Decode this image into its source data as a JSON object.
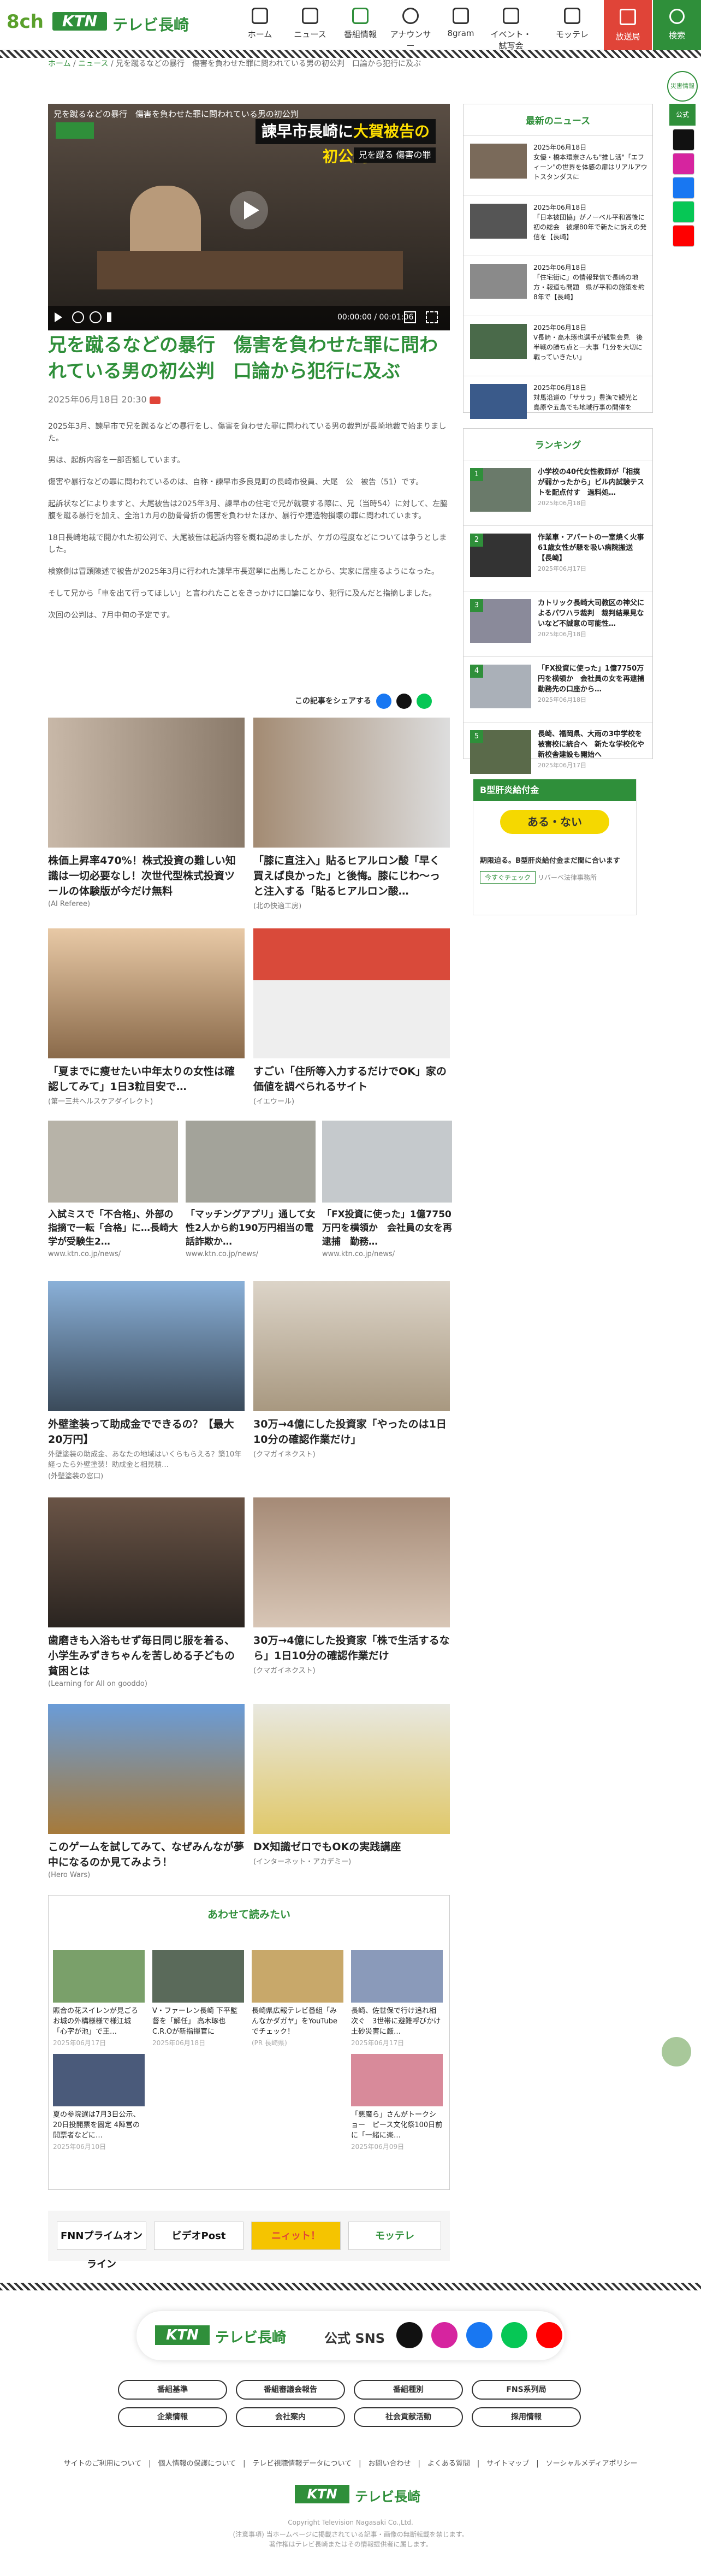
{
  "header": {
    "logo_8ch": "8ch",
    "logo_ktn": "KTN",
    "logo_tv": "テレビ長崎",
    "nav": [
      {
        "label": "ホーム",
        "icon": "home-icon"
      },
      {
        "label": "ニュース",
        "icon": "news-icon"
      },
      {
        "label": "番組情報",
        "icon": "tv-icon"
      },
      {
        "label": "アナウンサー",
        "icon": "announcer-icon"
      },
      {
        "label": "8gram",
        "icon": "camera-icon"
      },
      {
        "label": "イベント・試写会",
        "icon": "event-icon"
      },
      {
        "label": "モッテレ",
        "icon": "shop-icon"
      }
    ],
    "live": "放送局",
    "search": "検索"
  },
  "right_rail": {
    "label": "災害情報",
    "sns_label": "公式SNS"
  },
  "breadcrumb": {
    "home": "ホーム",
    "sep": "/",
    "news": "ニュース",
    "current": "兄を蹴るなどの暴行　傷害を負わせた罪に問われている男の初公判　口論から犯行に及ぶ"
  },
  "video": {
    "caption": "兄を蹴るなどの暴行　傷害を負わせた罪に問われている男の初公判",
    "title_white": "諫早市長崎に",
    "title_yellow": "大賀被告の初公判",
    "subtitle": "兄を蹴る 傷害の罪",
    "time": "00:00:00 / 00:01:06"
  },
  "article": {
    "title": "兄を蹴るなどの暴行　傷害を負わせた罪に問われている男の初公判　口論から犯行に及ぶ",
    "date": "2025年06月18日 20:30",
    "paragraphs": [
      "2025年3月、諫早市で兄を蹴るなどの暴行をし、傷害を負わせた罪に問われている男の裁判が長崎地裁で始まりました。",
      "男は、起訴内容を一部否認しています。",
      "傷害や暴行などの罪に問われているのは、自称・諫早市多良見町の長崎市役員、大尾　公　被告（51）です。",
      "起訴状などによりますと、大尾被告は2025年3月、諫早市の住宅で兄が就寝する際に、兄（当時54）に対して、左脇腹を蹴る暴行を加え、全治1カ月の肋骨骨折の傷害を負わせたほか、暴行や建造物損壊の罪に問われています。",
      "18日長崎地裁で開かれた初公判で、大尾被告は起訴内容を概ね認めましたが、ケガの程度などについては争うとしました。",
      "検察側は冒頭陳述で被告が2025年3月に行われた諫早市長選挙に出馬したことから、実家に居座るようになった。",
      "そして兄から「車を出て行ってほしい」と言われたことをきっかけに口論になり、犯行に及んだと指摘しました。",
      "次回の公判は、7月中旬の予定です。"
    ],
    "share_label": "この記事をシェアする"
  },
  "ads": [
    {
      "title": "株価上昇率470%！株式投資の難しい知識は一切必要なし！次世代型株式投資ツールの体験版が今だけ無料",
      "src": "(AI Referee)"
    },
    {
      "title": "「膝に直注入」貼るヒアルロン酸「早く買えば良かった」と後悔。膝にじわ〜っと注入する「貼るヒアルロン酸…",
      "src": "(北の快適工房)"
    },
    {
      "title": "「夏までに痩せたい中年太りの女性は確認してみて」1日3粒目安で…",
      "src": "(第一三共ヘルスケアダイレクト)"
    },
    {
      "title": "すごい「住所等入力するだけでOK」家の価値を調べられるサイト",
      "src": "(イエウール)"
    },
    {
      "title": "入試ミスで「不合格」、外部の指摘で一転「合格」に…長崎大学が受験生2…",
      "src": "www.ktn.co.jp/news/"
    },
    {
      "title": "「マッチングアプリ」通して女性2人から約190万円相当の電話詐欺か…",
      "src": "www.ktn.co.jp/news/"
    },
    {
      "title": "「FX投資に使った」1億7750万円を横領か　会社員の女を再逮捕　勤務…",
      "src": "www.ktn.co.jp/news/"
    },
    {
      "title": "外壁塗装って助成金でできるの？【最大20万円】",
      "desc": "外壁塗装の助成金、あなたの地域はいくらもらえる？築10年経ったら外壁塗装！助成金と相見積…",
      "src": "(外壁塗装の窓口)"
    },
    {
      "title": "30万→4億にした投資家「やったのは1日10分の確認作業だけ」",
      "src": "(クマガイネクスト)"
    },
    {
      "title": "歯磨きも入浴もせず毎日同じ服を着る、小学生みずきちゃんを苦しめる子どもの貧困とは",
      "src": "(Learning for All on gooddo)"
    },
    {
      "title": "30万→4億にした投資家「株で生活するなら」1日10分の確認作業だけ",
      "src": "(クマガイネクスト)"
    },
    {
      "title": "このゲームを試してみて、なぜみんなが夢中になるのか見てみよう！",
      "src": "(Hero Wars)"
    },
    {
      "title": "DX知識ゼロでもOKの実践講座",
      "src": "(インターネット・アカデミー)"
    }
  ],
  "sidebar": {
    "latest_title": "最新のニュース",
    "latest": [
      {
        "text": "2025年06月18日\n女優・橋本環奈さんも\"推し活\"「エフィーン\"の世界を体感の扉はリアルアウトスタンダスに"
      },
      {
        "text": "2025年06月18日\n「日本被団協」がノーベル平和賞後に初の総会　被爆80年で新たに訴えの発信を【長崎】"
      },
      {
        "text": "2025年06月18日\n「住宅街に」の情報発信で長崎の地方・報道も問題　県が平和の施策を約8年で【長崎】"
      },
      {
        "text": "2025年06月18日\nV長崎・高木琢也選手が観覧会見　後半戦の勝ち点と一大事「1分を大切に戦っていきたい」"
      },
      {
        "text": "2025年06月18日\n対馬沿道の「ササラ」豊漁で観光と　島原や五島でも地域行事の開催を"
      }
    ],
    "ranking_title": "ランキング",
    "ranking": [
      {
        "num": "1",
        "text": "小学校の40代女性教師が「相撲が弱かったから」ビル内試験テストを配点付す　過料処…",
        "date": "2025年06月18日"
      },
      {
        "num": "2",
        "text": "作業車・アパートの一室焼く火事　61歳女性が懸を吸い病院搬送【長崎】",
        "date": "2025年06月17日"
      },
      {
        "num": "3",
        "text": "カトリック長崎大司教区の神父によるパワハラ裁判　裁判結果見ないなど不誠意の可能性…",
        "date": "2025年06月18日"
      },
      {
        "num": "4",
        "text": "「FX投資に使った」1億7750万円を横領か　会社員の女を再逮捕　勤務先の口座から…",
        "date": "2025年06月18日"
      },
      {
        "num": "5",
        "text": "長崎、福岡県、大雨の3中学校を被害校に統合へ　新たな学校化や新校舎建設も開始へ",
        "date": "2025年06月17日"
      }
    ],
    "promo_title": "ある・ない",
    "promo_line1": "B型肝炎給付金",
    "promo_text": "期限迫る。B型肝炎給付金まだ間に合います",
    "promo_btn": "今すぐチェック",
    "promo_src": "リバーベ法律事務所"
  },
  "related": {
    "title": "あわせて読みたい",
    "items": [
      {
        "t": "賑合の花スイレンが見ごろ　お城の外構様様で様江城「心字が池」で王…",
        "d": "2025年06月17日"
      },
      {
        "t": "V・ファーレン長崎 下平監督を「解任」 高木琢也C.R.Oが新指揮官に",
        "d": "2025年06月18日"
      },
      {
        "t": "長崎県広報テレビ番組「みんなかダガヤ」をYouTubeでチェック！",
        "d": "(PR 長崎県)"
      },
      {
        "t": "長崎、佐世保で行け追れ相次ぐ　3世帯に避難呼びかけ　土砂災害に厳…",
        "d": "2025年06月17日"
      },
      {
        "t": "夏の参院選は7月3日公示、20日投開票を固定 4陣営の開票者などに…",
        "d": "2025年06月10日"
      },
      {
        "t": "「悪魔ら」さんがトークショー　ピース文化祭100日前に「一緒に楽…",
        "d": "2025年06月09日"
      }
    ]
  },
  "banners": [
    "FNNプライムオンライン",
    "ビデオPost",
    "ニィット！",
    "モッテレ"
  ],
  "footer": {
    "brand": "テレビ長崎",
    "sns": "公式 SNS",
    "pills": [
      "番組基準",
      "番組審議会報告",
      "番組種別",
      "FNS系列局",
      "企業情報",
      "会社案内",
      "社会貢献活動",
      "採用情報"
    ],
    "links": "サイトのご利用について　|　個人情報の保護について　|　テレビ視聴情報データについて　|　お問い合わせ　|　よくある質問　|　サイトマップ　|　ソーシャルメディアポリシー",
    "copyright": "Copyright Television Nagasaki Co.,Ltd.",
    "note1": "(注意事項) 当ホームページに掲載されている記事・画像の無断転載を禁じます。",
    "note2": "著作権はテレビ長崎またはその情報提供者に属します。"
  }
}
